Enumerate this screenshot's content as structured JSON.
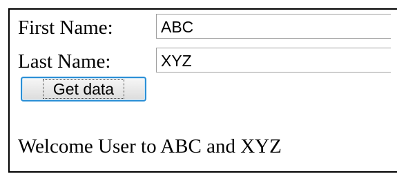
{
  "form": {
    "first_name_label": "First Name:",
    "first_name_value": "ABC",
    "last_name_label": "Last Name:",
    "last_name_value": "XYZ",
    "get_data_label": "Get data"
  },
  "output": {
    "welcome_text": "Welcome User to ABC and XYZ"
  }
}
